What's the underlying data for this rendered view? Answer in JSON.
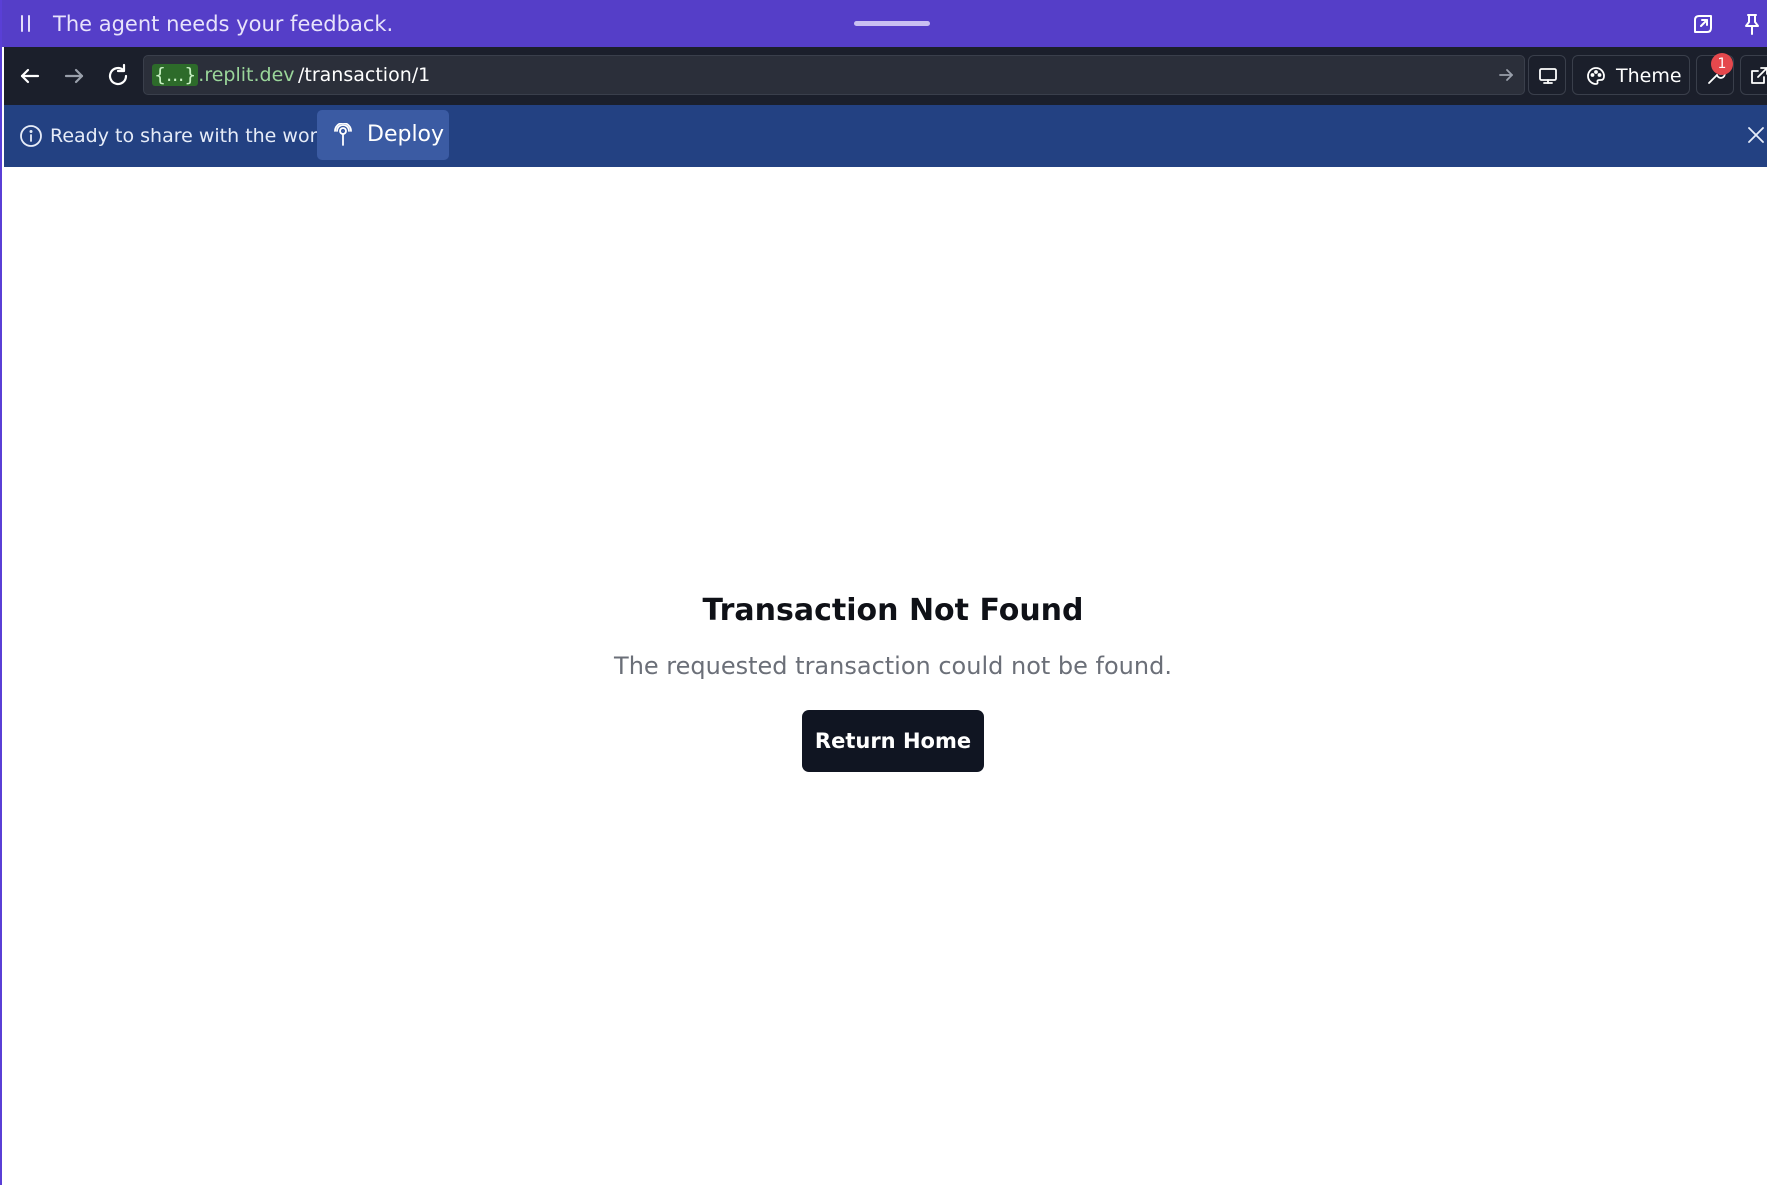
{
  "agent_bar": {
    "message": "The agent needs your feedback."
  },
  "toolbar": {
    "url_host_tag": "{...}",
    "url_host": ".replit.dev",
    "url_path": "/transaction/1",
    "theme_label": "Theme",
    "notification_count": "1"
  },
  "banner": {
    "text": "Ready to share with the world?",
    "deploy_label": "Deploy"
  },
  "page": {
    "title": "Transaction Not Found",
    "message": "The requested transaction could not be found.",
    "return_label": "Return Home"
  },
  "icons": {
    "agent_bar": [
      "pause-icon",
      "open-popout-icon",
      "pin-icon"
    ],
    "toolbar": [
      "back-arrow-icon",
      "forward-arrow-icon",
      "reload-icon",
      "go-arrow-icon",
      "device-preview-icon",
      "palette-icon",
      "tools-icon",
      "external-link-icon"
    ],
    "banner": [
      "info-icon",
      "deploy-icon",
      "close-icon"
    ]
  },
  "colors": {
    "agent_bar": "#553ec8",
    "toolbar": "#1b1f2b",
    "banner": "#234182",
    "deploy_button": "#3b5ba3",
    "primary_button": "#101522",
    "badge": "#e5484d"
  }
}
